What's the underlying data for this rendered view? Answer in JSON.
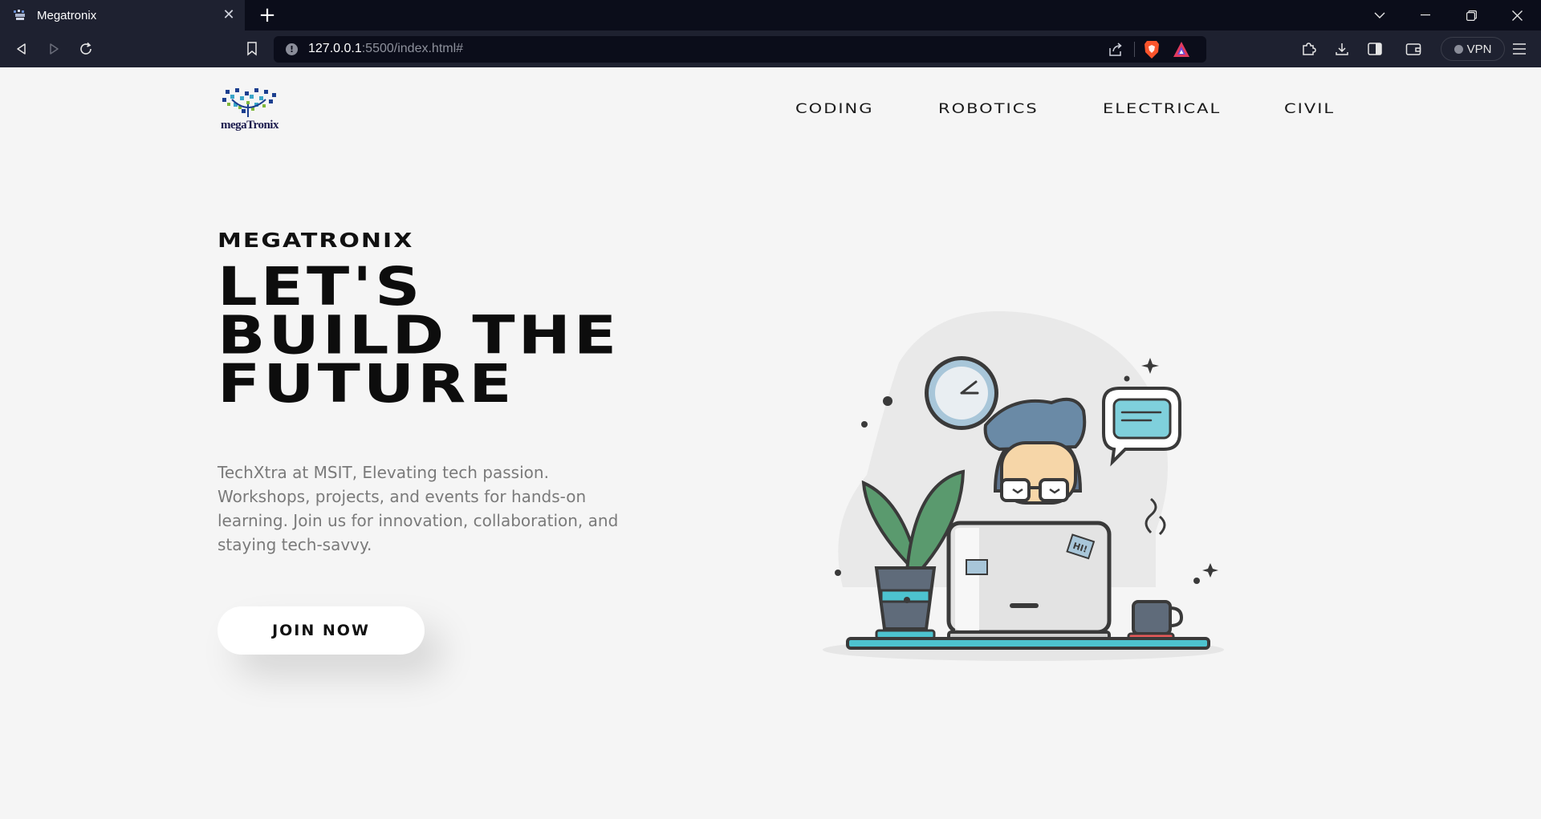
{
  "browser": {
    "tab_title": "Megatronix",
    "new_tab_symbol": "+",
    "close_symbol": "✕",
    "url_host": "127.0.0.1",
    "url_rest": ":5500/index.html#",
    "vpn_label": "VPN",
    "icons": {
      "back": "back-arrow-icon",
      "forward": "forward-arrow-icon",
      "reload": "reload-icon",
      "bookmark": "bookmark-icon",
      "site_info": "info-icon",
      "share": "share-icon",
      "brave": "brave-shields-icon",
      "rewards": "brave-rewards-icon",
      "extensions": "puzzle-icon",
      "downloads": "download-icon",
      "sidebar": "sidebar-icon",
      "wallet": "wallet-icon",
      "menu": "hamburger-menu-icon",
      "tab_list": "chevron-down-icon",
      "minimize": "minimize-icon",
      "restore": "restore-icon",
      "close_window": "close-icon"
    },
    "colors": {
      "tabbar": "#0b0d1a",
      "toolbar": "#1e2130",
      "brave_orange": "#fb542b"
    }
  },
  "site": {
    "logo_text": "megaTronix",
    "nav": [
      "CODING",
      "ROBOTICS",
      "ELECTRICAL",
      "CIVIL"
    ],
    "hero": {
      "kicker": "MEGATRONIX",
      "title": "LET'S BUILD THE FUTURE",
      "description": "TechXtra at MSIT, Elevating tech passion. Workshops, projects, and events for hands-on learning. Join us for innovation, collaboration, and staying tech-savvy.",
      "cta": "JOIN NOW"
    },
    "illustration": {
      "name": "developer-at-laptop-illustration",
      "laptop_sticker": "HI!"
    },
    "colors": {
      "background": "#f5f5f5",
      "text": "#0d0d0d",
      "muted": "#7a7a7a",
      "accent_teal": "#4dc3cf",
      "plant_green": "#5a9a6e"
    }
  }
}
